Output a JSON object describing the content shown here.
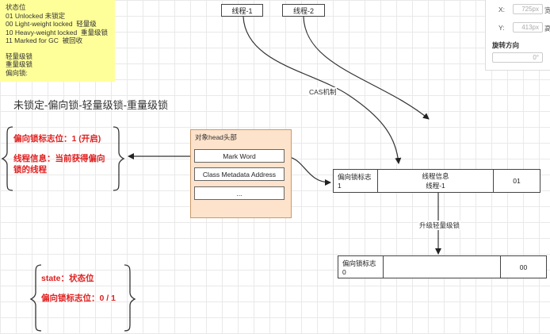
{
  "note": {
    "lines": [
      "状态位",
      "01 Unlocked 未锁定",
      "00 Light-weight locked  轻量级",
      "10 Heavy-weight locked  重量级锁",
      "11 Marked for GC  被回收",
      "",
      "轻量级锁",
      "重量级锁",
      "偏向锁:"
    ]
  },
  "threads": {
    "thread1": "线程-1",
    "thread2": "线程-2"
  },
  "section_title": "未锁定-偏向锁-轻量级锁-重量级锁",
  "brace_top": {
    "line1": "偏向锁标志位：1 (开启)",
    "line2": "线程信息：当前获得偏向",
    "line3": "锁的线程"
  },
  "brace_bottom": {
    "line1": "state：状态位",
    "line2": "偏向锁标志位：0 / 1"
  },
  "object_head": {
    "title": "对象head头部",
    "fields": [
      "Mark Word",
      "Class Metadata Address",
      "..."
    ]
  },
  "edges": {
    "cas": "CAS机制",
    "upgrade": "升级轻量级锁"
  },
  "row_top": {
    "c1_line1": "偏向锁标志",
    "c1_line2": "1",
    "c2_line1": "线程信息",
    "c2_line2": "线程-1",
    "c3": "01"
  },
  "row_bottom": {
    "c1_line1": "偏向锁标志",
    "c1_line2": "0",
    "c2": "",
    "c3": "00"
  },
  "panel": {
    "x_label": "X:",
    "x_value": "725px",
    "x_suffix": "宽",
    "y_label": "Y:",
    "y_value": "413px",
    "y_suffix": "高",
    "rotate_label": "旋转方向",
    "rotate_value": "0°"
  }
}
